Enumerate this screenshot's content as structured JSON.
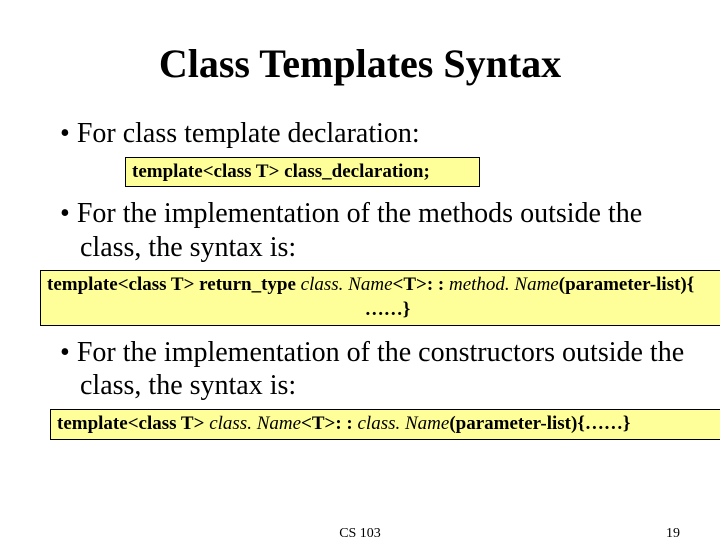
{
  "title": "Class Templates Syntax",
  "bullets": {
    "b1": "For class template declaration:",
    "b2": "For the implementation of the methods outside the class, the syntax is:",
    "b3": "For the implementation of the constructors outside the class, the syntax is:"
  },
  "code": {
    "c1": "template<class T> class_declaration;",
    "c2_prefix": "template<class T> return_type ",
    "c2_classname": "class. Name",
    "c2_mid1": "<T>: : ",
    "c2_method": "method. Name",
    "c2_mid2": "(parameter-list){",
    "c2_line2": "……}",
    "c3_prefix": "template<class T>  ",
    "c3_classname1": "class. Name",
    "c3_mid1": "<T>: : ",
    "c3_classname2": "class. Name",
    "c3_mid2": "(parameter-list){……}"
  },
  "footer": {
    "center": "CS 103",
    "page": "19"
  }
}
